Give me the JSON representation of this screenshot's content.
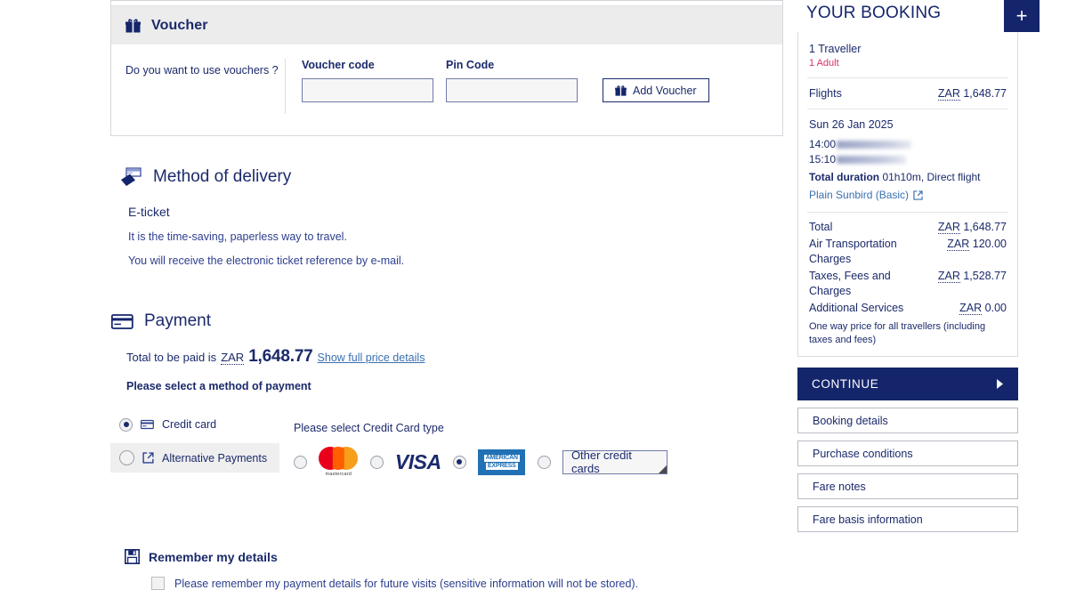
{
  "voucher": {
    "title": "Voucher",
    "icon": "gift-icon",
    "question": "Do you want to use vouchers ?",
    "code_label": "Voucher code",
    "code_value": "",
    "pin_label": "Pin Code",
    "pin_value": "",
    "add_button": "Add Voucher"
  },
  "delivery": {
    "title": "Method of delivery",
    "icon": "envelope-send-icon",
    "subtitle": "E-ticket",
    "line1": "It is the time-saving, paperless way to travel.",
    "line2": "You will receive the electronic ticket reference by e-mail."
  },
  "payment": {
    "title": "Payment",
    "icon": "credit-card-icon",
    "total_prefix": "Total to be paid is",
    "currency": "ZAR",
    "amount": "1,648.77",
    "details_link": "Show full price details",
    "select_prompt": "Please select a method of payment",
    "methods": [
      {
        "label": "Credit card",
        "icon": "credit-card-icon",
        "selected": true
      },
      {
        "label": "Alternative Payments",
        "icon": "external-link-icon",
        "selected": false
      }
    ],
    "card_type_label": "Please select Credit Card type",
    "card_types": [
      {
        "name": "mastercard",
        "label": "mastercard",
        "selected": false
      },
      {
        "name": "visa",
        "label": "VISA",
        "selected": false
      },
      {
        "name": "amex",
        "label_top": "AMERICAN",
        "label_bottom": "EXPRESS",
        "selected": true
      },
      {
        "name": "other",
        "label": "Other credit cards",
        "selected": false
      }
    ]
  },
  "remember": {
    "title": "Remember my details",
    "icon": "save-floppy-icon",
    "checkbox_label": "Please remember my payment details for future visits (sensitive information will not be stored).",
    "checked": false
  },
  "sidebar": {
    "title": "YOUR BOOKING",
    "expand_icon": "plus-icon",
    "travellers": "1 Traveller",
    "traveller_detail": "1 Adult",
    "flights_label": "Flights",
    "flights_currency": "ZAR",
    "flights_amount": "1,648.77",
    "flight": {
      "date": "Sun 26 Jan 2025",
      "depart_time": "14:00",
      "arrive_time": "15:10",
      "duration_label": "Total duration",
      "duration_value": "01h10m, Direct flight",
      "fare_name": "Plain Sunbird (Basic)",
      "fare_icon": "external-link-icon"
    },
    "price_lines": [
      {
        "label": "Total",
        "currency": "ZAR",
        "value": "1,648.77"
      },
      {
        "label": "Air Transportation Charges",
        "currency": "ZAR",
        "value": "120.00"
      },
      {
        "label": "Taxes, Fees and Charges",
        "currency": "ZAR",
        "value": "1,528.77"
      },
      {
        "label": "Additional Services",
        "currency": "ZAR",
        "value": "0.00"
      }
    ],
    "price_note": "One way price for all travellers (including taxes and fees)",
    "continue_label": "CONTINUE",
    "continue_icon": "chevron-right-icon",
    "links": [
      "Booking details",
      "Purchase conditions",
      "Fare notes",
      "Fare basis information"
    ]
  },
  "colors": {
    "brand_navy": "#15256b",
    "text_navy": "#1b2a6b",
    "link_blue": "#3a6fb0",
    "accent_pink": "#d6336c",
    "header_grey": "#ececec"
  }
}
